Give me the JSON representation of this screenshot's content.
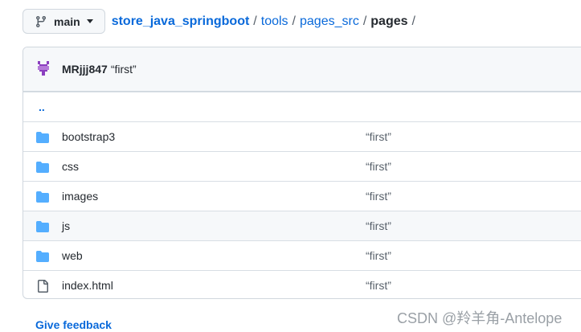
{
  "branch": {
    "label": "main"
  },
  "breadcrumb": {
    "repo": "store_java_springboot",
    "parts": [
      "tools",
      "pages_src"
    ],
    "current": "pages",
    "separator": "/"
  },
  "commit": {
    "author": "MRjjj847",
    "message": "“first”"
  },
  "parent_dir": "..",
  "files": [
    {
      "name": "bootstrap3",
      "type": "folder",
      "message": "“first”"
    },
    {
      "name": "css",
      "type": "folder",
      "message": "“first”"
    },
    {
      "name": "images",
      "type": "folder",
      "message": "“first”"
    },
    {
      "name": "js",
      "type": "folder",
      "message": "“first”"
    },
    {
      "name": "web",
      "type": "folder",
      "message": "“first”"
    },
    {
      "name": "index.html",
      "type": "file",
      "message": "“first”"
    }
  ],
  "footer": {
    "feedback": "Give feedback"
  },
  "watermark": "CSDN @羚羊角-Antelope",
  "colors": {
    "link": "#0969da",
    "folder": "#54aeff",
    "avatar": "#8b3fbf"
  }
}
